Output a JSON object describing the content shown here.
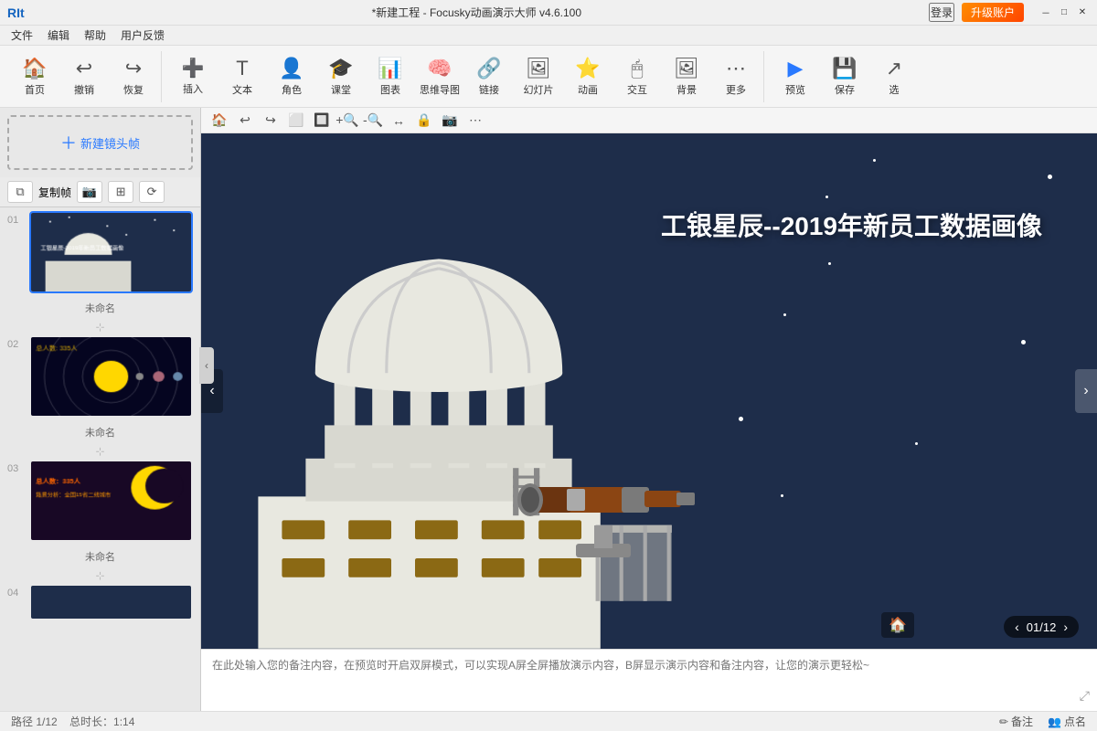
{
  "app": {
    "logo": "RIt",
    "title": "*新建工程 - Focusky动画演示大师 v4.6.100",
    "login_label": "登录",
    "upgrade_label": "升级账户"
  },
  "menu": {
    "items": [
      "文件",
      "编辑",
      "帮助",
      "用户反馈"
    ]
  },
  "toolbar": {
    "groups": [
      {
        "items": [
          {
            "id": "home",
            "label": "首页",
            "icon": "🏠"
          },
          {
            "id": "undo",
            "label": "撤销",
            "icon": "↩"
          },
          {
            "id": "redo",
            "label": "恢复",
            "icon": "↪"
          }
        ]
      },
      {
        "items": [
          {
            "id": "insert",
            "label": "插入",
            "icon": "➕"
          },
          {
            "id": "text",
            "label": "文本",
            "icon": "📝"
          },
          {
            "id": "role",
            "label": "角色",
            "icon": "👤"
          },
          {
            "id": "lesson",
            "label": "课堂",
            "icon": "🎓"
          },
          {
            "id": "chart",
            "label": "图表",
            "icon": "📊"
          },
          {
            "id": "mindmap",
            "label": "思维导图",
            "icon": "🧠"
          },
          {
            "id": "link",
            "label": "链接",
            "icon": "🔗"
          },
          {
            "id": "ppt",
            "label": "幻灯片",
            "icon": "🖼"
          },
          {
            "id": "animation",
            "label": "动画",
            "icon": "🎬"
          },
          {
            "id": "interact",
            "label": "交互",
            "icon": "🖱"
          },
          {
            "id": "background",
            "label": "背景",
            "icon": "🎨"
          },
          {
            "id": "more",
            "label": "更多",
            "icon": "⋯"
          }
        ]
      },
      {
        "items": [
          {
            "id": "preview",
            "label": "预览",
            "icon": "▶"
          },
          {
            "id": "save",
            "label": "保存",
            "icon": "💾"
          },
          {
            "id": "select",
            "label": "选",
            "icon": "↗"
          }
        ]
      }
    ]
  },
  "canvas_toolbar": {
    "icons": [
      "🏠",
      "↩",
      "↪",
      "⬜",
      "🔲",
      "🔍",
      "🔍",
      "↔",
      "🔒",
      "📷",
      "⋯"
    ]
  },
  "sidebar": {
    "new_frame_label": "新建镜头帧",
    "copy_label": "复制帧",
    "slides": [
      {
        "num": "01",
        "label": "未命名",
        "active": true
      },
      {
        "num": "02",
        "label": "未命名",
        "active": false
      },
      {
        "num": "03",
        "label": "未命名",
        "active": false
      },
      {
        "num": "04",
        "label": "",
        "active": false
      }
    ]
  },
  "slide": {
    "title": "工银星辰--2019年新员工数据画像"
  },
  "notes": {
    "placeholder": "在此处输入您的备注内容，在预览时开启双屏模式，可以实现A屏全屏播放演示内容，B屏显示演示内容和备注内容，让您的演示更轻松~"
  },
  "statusbar": {
    "path": "路径 1/12",
    "duration": "总时长：1:14",
    "notes_label": "备注",
    "rollcall_label": "点名"
  },
  "pagination": {
    "current": "01/12",
    "prev": "‹",
    "next": "›"
  },
  "window_controls": {
    "minimize": "－",
    "maximize": "□",
    "close": "✕"
  }
}
